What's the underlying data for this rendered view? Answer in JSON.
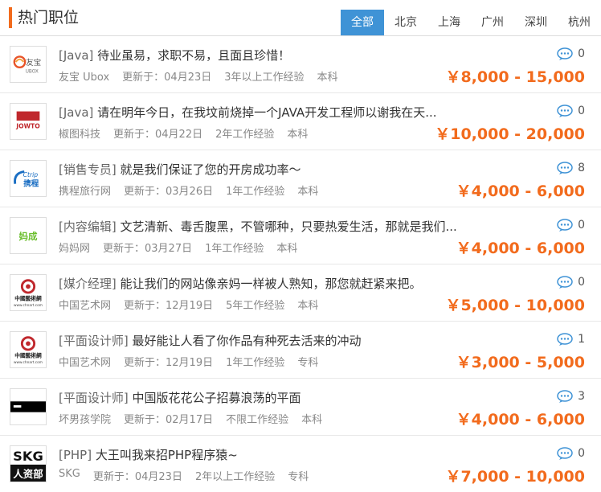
{
  "header": {
    "title": "热门职位",
    "tabs": [
      {
        "label": "全部",
        "active": true
      },
      {
        "label": "北京",
        "active": false
      },
      {
        "label": "上海",
        "active": false
      },
      {
        "label": "广州",
        "active": false
      },
      {
        "label": "深圳",
        "active": false
      },
      {
        "label": "杭州",
        "active": false
      }
    ]
  },
  "colors": {
    "accent": "#f26b1d",
    "tab_active": "#3f93d6",
    "comment_icon": "#3f93d6"
  },
  "jobs": [
    {
      "category": "[Java]",
      "title": "待业虽易，求职不易，且面且珍惜！",
      "company": "友宝 Ubox",
      "updated": "更新于：04月23日",
      "experience": "3年以上工作经验",
      "education": "本科",
      "comments": "0",
      "salary": "￥8,000 - 15,000",
      "logo": "ubox-logo"
    },
    {
      "category": "[Java]",
      "title": "请在明年今日，在我坟前烧掉一个JAVA开发工程师以谢我在天...",
      "company": "椒图科技",
      "updated": "更新于：04月22日",
      "experience": "2年工作经验",
      "education": "本科",
      "comments": "0",
      "salary": "￥10,000 - 20,000",
      "logo": "jowto-logo"
    },
    {
      "category": "[销售专员]",
      "title": "就是我们保证了您的开房成功率～",
      "company": "携程旅行网",
      "updated": "更新于：03月26日",
      "experience": "1年工作经验",
      "education": "本科",
      "comments": "8",
      "salary": "￥4,000 - 6,000",
      "logo": "ctrip-logo"
    },
    {
      "category": "[内容编辑]",
      "title": "文艺清新、毒舌腹黑，不管哪种，只要热爱生活，那就是我们...",
      "company": "妈妈网",
      "updated": "更新于：03月27日",
      "experience": "1年工作经验",
      "education": "本科",
      "comments": "0",
      "salary": "￥4,000 - 6,000",
      "logo": "mama-logo"
    },
    {
      "category": "[媒介经理]",
      "title": "能让我们的网站像亲妈一样被人熟知，那您就赶紧来把。",
      "company": "中国艺术网",
      "updated": "更新于：12月19日",
      "experience": "5年工作经验",
      "education": "本科",
      "comments": "0",
      "salary": "￥5,000 - 10,000",
      "logo": "chnart-logo"
    },
    {
      "category": "[平面设计师]",
      "title": "最好能让人看了你作品有种死去活来的冲动",
      "company": "中国艺术网",
      "updated": "更新于：12月19日",
      "experience": "1年工作经验",
      "education": "专科",
      "comments": "1",
      "salary": "￥3,000 - 5,000",
      "logo": "chnart-logo"
    },
    {
      "category": "[平面设计师]",
      "title": "中国版花花公子招募浪荡的平面",
      "company": "坏男孩学院",
      "updated": "更新于：02月17日",
      "experience": "不限工作经验",
      "education": "本科",
      "comments": "3",
      "salary": "￥4,000 - 6,000",
      "logo": "badboy-logo"
    },
    {
      "category": "[PHP]",
      "title": "大王叫我来招PHP程序猿~",
      "company": "SKG",
      "updated": "更新于：04月23日",
      "experience": "2年以上工作经验",
      "education": "专科",
      "comments": "0",
      "salary": "￥7,000 - 10,000",
      "logo": "skg-logo"
    }
  ],
  "logo_text": {
    "ubox": [
      "友宝",
      "UBOX"
    ],
    "jowto": "JOWTO",
    "ctrip": [
      "Ctrip",
      "携程"
    ],
    "mama": "妈成",
    "chnart": [
      "中國藝術網",
      "www.chnart.com"
    ],
    "skg": [
      "SKG",
      "人资部"
    ]
  }
}
